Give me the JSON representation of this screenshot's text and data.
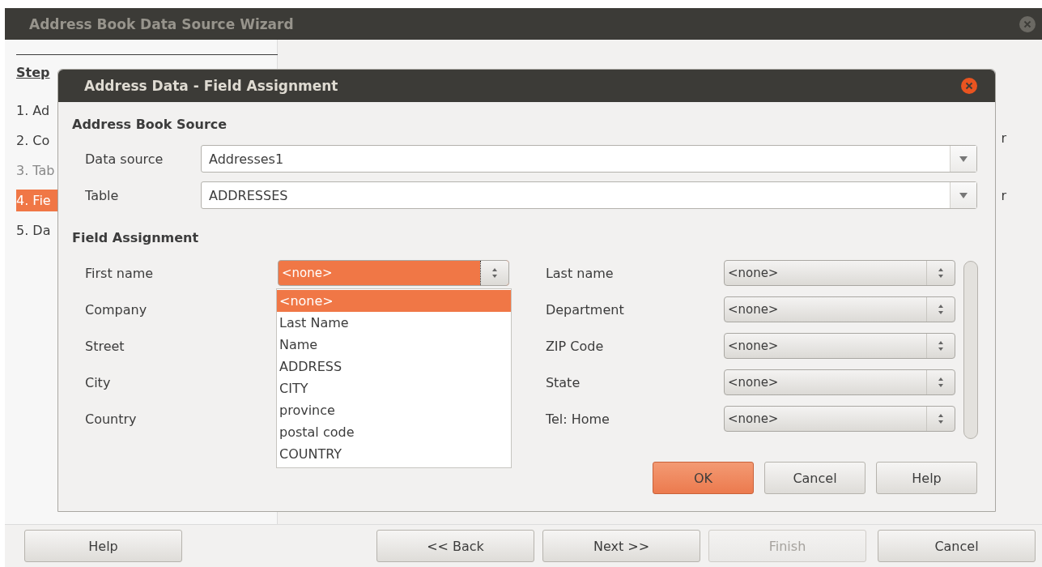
{
  "window": {
    "title": "Address Book Data Source Wizard"
  },
  "steps": {
    "heading": "Step",
    "items": [
      {
        "label": "1. Ad",
        "selected": false,
        "disabled": false
      },
      {
        "label": "2. Co",
        "selected": false,
        "disabled": false
      },
      {
        "label": "3. Tab",
        "selected": false,
        "disabled": true
      },
      {
        "label": "4. Fie",
        "selected": true,
        "disabled": false
      },
      {
        "label": "5. Da",
        "selected": false,
        "disabled": false
      }
    ]
  },
  "content_fragments": [
    "r",
    "r"
  ],
  "dialog": {
    "title": "Address Data - Field Assignment",
    "source_heading": "Address Book Source",
    "source_fields": [
      {
        "label": "Data source",
        "value": "Addresses1"
      },
      {
        "label": "Table",
        "value": "ADDRESSES"
      }
    ],
    "assignment_heading": "Field Assignment",
    "rows": [
      {
        "left": {
          "label": "First name",
          "value": "<none>",
          "open": true
        },
        "right": {
          "label": "Last name",
          "value": "<none>"
        }
      },
      {
        "left": {
          "label": "Company"
        },
        "right": {
          "label": "Department",
          "value": "<none>"
        }
      },
      {
        "left": {
          "label": "Street"
        },
        "right": {
          "label": "ZIP Code",
          "value": "<none>"
        }
      },
      {
        "left": {
          "label": "City"
        },
        "right": {
          "label": "State",
          "value": "<none>"
        }
      },
      {
        "left": {
          "label": "Country"
        },
        "right": {
          "label": "Tel: Home",
          "value": "<none>"
        }
      }
    ],
    "dropdown": [
      {
        "label": "<none>",
        "selected": true
      },
      {
        "label": "Last Name",
        "selected": false
      },
      {
        "label": "Name",
        "selected": false
      },
      {
        "label": "ADDRESS",
        "selected": false
      },
      {
        "label": "CITY",
        "selected": false
      },
      {
        "label": "province",
        "selected": false
      },
      {
        "label": "postal code",
        "selected": false
      },
      {
        "label": "COUNTRY",
        "selected": false
      }
    ],
    "buttons": [
      {
        "label": "OK",
        "default": true
      },
      {
        "label": "Cancel",
        "default": false
      },
      {
        "label": "Help",
        "default": false
      }
    ]
  },
  "footer_buttons": [
    {
      "label": "Help",
      "disabled": false
    },
    {
      "label": "<< Back",
      "disabled": false
    },
    {
      "label": "Next >>",
      "disabled": false
    },
    {
      "label": "Finish",
      "disabled": true
    },
    {
      "label": "Cancel",
      "disabled": false
    }
  ]
}
